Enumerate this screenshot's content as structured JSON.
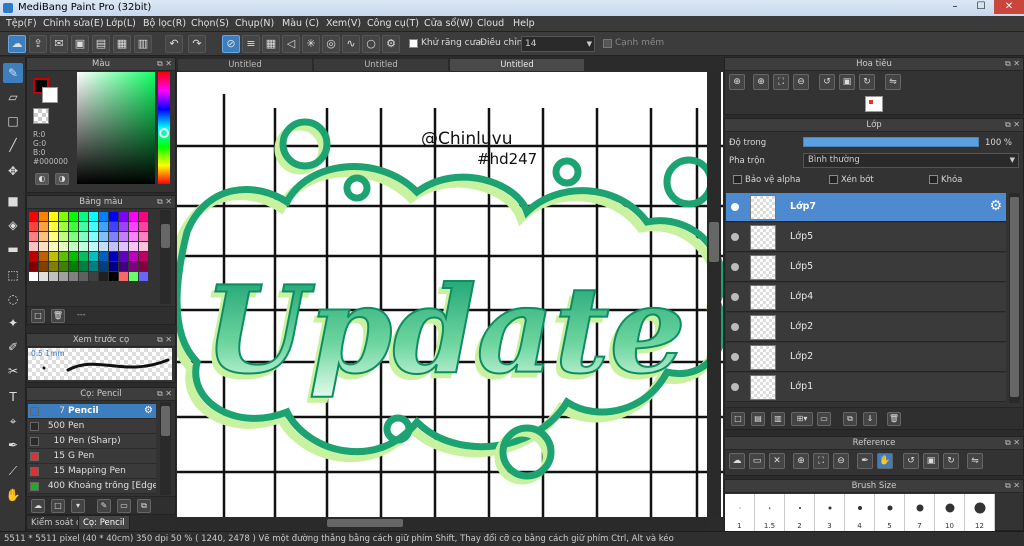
{
  "window": {
    "title": "MediBang Paint Pro (32bit)",
    "min": "–",
    "max": "☐",
    "close": "✕"
  },
  "menu": [
    "Tệp(F)",
    "Chỉnh sửa(E)",
    "Lớp(L)",
    "Bộ lọc(R)",
    "Chọn(S)",
    "Chụp(N)",
    "Màu (C)",
    "Xem(V)",
    "Công cụ(T)",
    "Cửa sổ(W)",
    "Cloud",
    "Help"
  ],
  "toolbar": {
    "antialias_label": "Khử răng cưa",
    "correction_label": "Điều chỉnh",
    "correction_value": "14",
    "snap_label": "Cạnh mềm"
  },
  "panels": {
    "color": {
      "title": "Màu",
      "r": "R:0",
      "g": "G:0",
      "b": "B:0",
      "hex": "#000000"
    },
    "palette": {
      "title": "Bảng màu",
      "footer_text": "---",
      "colors": [
        "#ff0000",
        "#ff8000",
        "#ffff00",
        "#80ff00",
        "#00ff00",
        "#00ff80",
        "#00ffff",
        "#0080ff",
        "#0000ff",
        "#8000ff",
        "#ff00ff",
        "#ff0080",
        "#ff4040",
        "#ffa040",
        "#ffff40",
        "#a0ff40",
        "#40ff40",
        "#40ffa0",
        "#40ffff",
        "#40a0ff",
        "#4040ff",
        "#a040ff",
        "#ff40ff",
        "#ff40a0",
        "#ff8080",
        "#ffc080",
        "#ffff80",
        "#c0ff80",
        "#80ff80",
        "#80ffc0",
        "#80ffff",
        "#80c0ff",
        "#8080ff",
        "#c080ff",
        "#ff80ff",
        "#ff80c0",
        "#ffc0c0",
        "#ffe0c0",
        "#ffffc0",
        "#e0ffc0",
        "#c0ffc0",
        "#c0ffe0",
        "#c0ffff",
        "#c0e0ff",
        "#c0c0ff",
        "#e0c0ff",
        "#ffc0ff",
        "#ffc0e0",
        "#c00000",
        "#c06000",
        "#c0c000",
        "#60c000",
        "#00c000",
        "#00c060",
        "#00c0c0",
        "#0060c0",
        "#0000c0",
        "#6000c0",
        "#c000c0",
        "#c00060",
        "#800000",
        "#804000",
        "#808000",
        "#408000",
        "#008000",
        "#008040",
        "#008080",
        "#004080",
        "#000080",
        "#400080",
        "#800080",
        "#800040",
        "#ffffff",
        "#e0e0e0",
        "#c0c0c0",
        "#a0a0a0",
        "#808080",
        "#606060",
        "#404040",
        "#202020",
        "#000000",
        "#ff6666",
        "#66ff66",
        "#6666ff"
      ]
    },
    "brush_preview": {
      "title": "Xem trước cọ",
      "size": "0.5 1mm"
    },
    "brush": {
      "title": "Cọ: Pencil",
      "items": [
        {
          "size": "7",
          "name": "Pencil",
          "color": "#3a7ac4"
        },
        {
          "size": "500",
          "name": "Pen",
          "color": "#2a2a2a"
        },
        {
          "size": "10",
          "name": "Pen (Sharp)",
          "color": "#2a2a2a"
        },
        {
          "size": "15",
          "name": "G Pen",
          "color": "#e03030"
        },
        {
          "size": "15",
          "name": "Mapping Pen",
          "color": "#e03030"
        },
        {
          "size": "400",
          "name": "Khoảng trống [Edge",
          "color": "#22aa22"
        }
      ]
    },
    "bottom_tabs": [
      "Kiểm soát cọ",
      "Cọ: Pencil"
    ],
    "navigator": {
      "title": "Hoa tiêu"
    },
    "layer": {
      "title": "Lớp",
      "opacity_label": "Độ trong",
      "opacity_value": "100 %",
      "opacity_fraction": 1.0,
      "blend_label": "Pha trộn",
      "blend_value": "Bình thường",
      "protect_alpha": "Bảo vệ alpha",
      "clipping": "Xén bớt",
      "lock": "Khóa",
      "layers": [
        "Lớp7",
        "Lớp5",
        "Lớp5",
        "Lớp4",
        "Lớp2",
        "Lớp2",
        "Lớp1"
      ]
    },
    "reference": {
      "title": "Reference"
    },
    "brush_size": {
      "title": "Brush Size",
      "sizes": [
        "1",
        "1.5",
        "2",
        "3",
        "4",
        "5",
        "7",
        "10",
        "12"
      ]
    }
  },
  "document_tabs": [
    "Untitled",
    "Untitled",
    "Untitled"
  ],
  "canvas": {
    "text_main": "Update",
    "signature_line1": "@Chinluvu",
    "signature_line2": "#hd247"
  },
  "status": "5511 * 5511 pixel  (40 * 40cm)  350 dpi  50 %  ( 1240, 2478 )  Vẽ một đường thẳng bằng cách giữ phím Shift, Thay đổi cỡ cọ bằng cách giữ phím Ctrl, Alt và kéo"
}
